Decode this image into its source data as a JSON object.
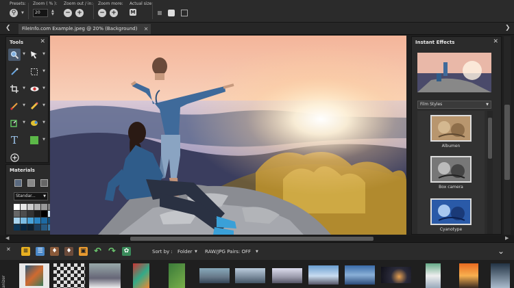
{
  "toolbar": {
    "presets_label": "Presets:",
    "zoom_label": "Zoom ( % ):",
    "zoom_value": "20",
    "zoom_out_in_label": "Zoom out / in:",
    "zoom_more_label": "Zoom more:",
    "actual_size_label": "Actual size:"
  },
  "document": {
    "tab_title": "FileInfo.com Example.jpeg @  20% (Background)"
  },
  "tools_panel": {
    "title": "Tools"
  },
  "materials_panel": {
    "title": "Materials",
    "style_value": "Standar..."
  },
  "effects_panel": {
    "title": "Instant Effects",
    "category": "Film Styles",
    "items": [
      {
        "label": "Albumen"
      },
      {
        "label": "Box camera"
      },
      {
        "label": "Cyanotype"
      }
    ]
  },
  "organizer": {
    "sort_label": "Sort by :",
    "sort_value": "Folder",
    "rawjpg_label": "RAW/JPG Pairs: OFF",
    "side_label": "anizer"
  },
  "colors": {
    "accent": "#4a5a6e",
    "panel_bg": "#2b2b2b",
    "app_bg": "#1e1e1e"
  }
}
